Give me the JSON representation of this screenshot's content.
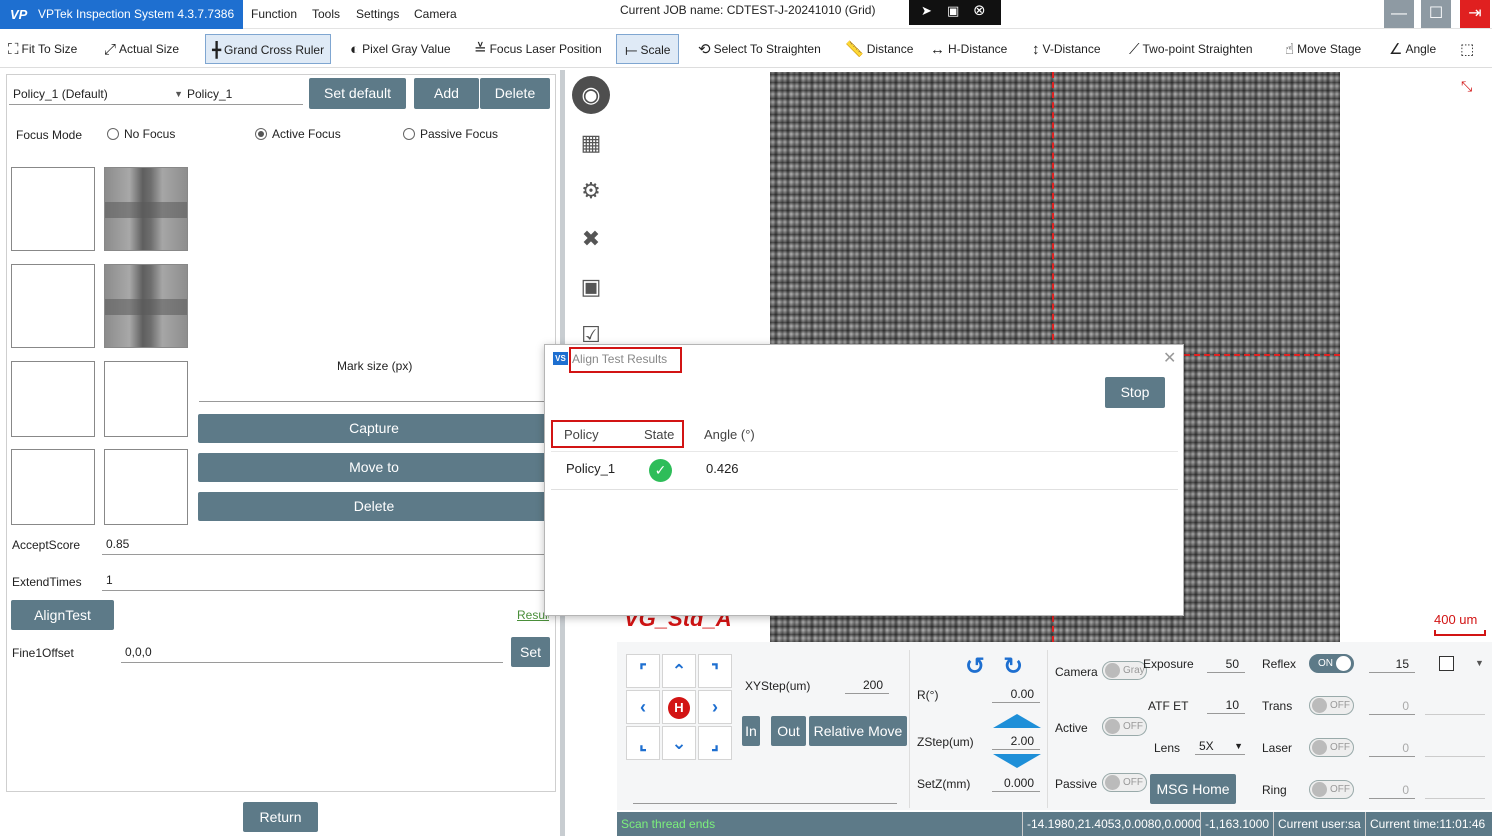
{
  "titlebar": {
    "app_title": "VPTek Inspection System 4.3.7.7386",
    "logo_text": "VP",
    "menu": [
      "Function",
      "Tools",
      "Settings",
      "Camera"
    ],
    "job_label": "Current JOB name:",
    "job_name": "CDTEST-J-20241010 (Grid)"
  },
  "toolbar": {
    "items": [
      {
        "label": "Fit To Size",
        "icon": "fit-icon"
      },
      {
        "label": "Actual Size",
        "icon": "expand-icon"
      },
      {
        "label": "Grand Cross Ruler",
        "icon": "cross-ruler-icon",
        "active": true
      },
      {
        "label": "Pixel Gray Value",
        "icon": "contrast-icon"
      },
      {
        "label": "Focus Laser Position",
        "icon": "laser-icon"
      },
      {
        "label": "Scale",
        "icon": "scale-icon",
        "active": true
      },
      {
        "label": "Select To Straighten",
        "icon": "rotate-icon"
      },
      {
        "label": "Distance",
        "icon": "ruler-icon"
      },
      {
        "label": "H-Distance",
        "icon": "h-distance-icon"
      },
      {
        "label": "V-Distance",
        "icon": "v-distance-icon"
      },
      {
        "label": "Two-point Straighten",
        "icon": "two-point-icon"
      },
      {
        "label": "Move Stage",
        "icon": "hand-icon"
      },
      {
        "label": "Angle",
        "icon": "angle-icon"
      }
    ]
  },
  "policy": {
    "selected": "Policy_1 (Default)",
    "name": "Policy_1",
    "set_default": "Set default",
    "add": "Add",
    "delete": "Delete"
  },
  "focus": {
    "label": "Focus Mode",
    "options": [
      "No Focus",
      "Active Focus",
      "Passive Focus"
    ],
    "selected": "Active Focus"
  },
  "mark": {
    "size_label": "Mark size (px)",
    "capture": "Capture",
    "move_to": "Move to",
    "delete": "Delete"
  },
  "params": {
    "accept_label": "AcceptScore",
    "accept_value": "0.85",
    "extend_label": "ExtendTimes",
    "extend_value": "1",
    "align_test": "AlignTest",
    "result_link": "Result",
    "fine_label": "Fine1Offset",
    "fine_value": "0,0,0",
    "set": "Set",
    "return": "Return"
  },
  "canvas": {
    "label": "VG_Std_A",
    "scale": "400 um"
  },
  "stage": {
    "xystep_label": "XYStep(um)",
    "xystep_value": "200",
    "r_label": "R(°)",
    "r_value": "0.00",
    "zstep_label": "ZStep(um)",
    "zstep_value": "2.00",
    "setz_label": "SetZ(mm)",
    "setz_value": "0.000",
    "in": "In",
    "out": "Out",
    "relative_move": "Relative Move",
    "home": "H"
  },
  "camera": {
    "camera_label": "Camera",
    "gray": "Gray",
    "exposure_label": "Exposure",
    "exposure_value": "50",
    "active_label": "Active",
    "atf_label": "ATF ET",
    "atf_value": "10",
    "lens_label": "Lens",
    "lens_value": "5X",
    "passive_label": "Passive",
    "msg_home": "MSG Home",
    "off": "OFF",
    "on": "ON"
  },
  "lights": {
    "reflex_label": "Reflex",
    "reflex_value": "15",
    "trans_label": "Trans",
    "trans_value": "0",
    "laser_label": "Laser",
    "laser_value": "0",
    "ring_label": "Ring",
    "ring_value": "0"
  },
  "status": {
    "message": "Scan thread ends",
    "coords": "-14.1980,21.4053,0.0080,0.0000",
    "pixel": "-1,163.1000",
    "user": "Current user:sa",
    "time": "Current time:11:01:46"
  },
  "dialog": {
    "title": "Align Test Results",
    "stop": "Stop",
    "columns": [
      "Policy",
      "State",
      "Angle (°)"
    ],
    "rows": [
      {
        "policy": "Policy_1",
        "state": "success",
        "angle": "0.426"
      }
    ]
  },
  "colors": {
    "accent": "#1e6fd0",
    "button": "#5d7a88",
    "highlight": "#d21414",
    "success": "#2ebd59"
  }
}
